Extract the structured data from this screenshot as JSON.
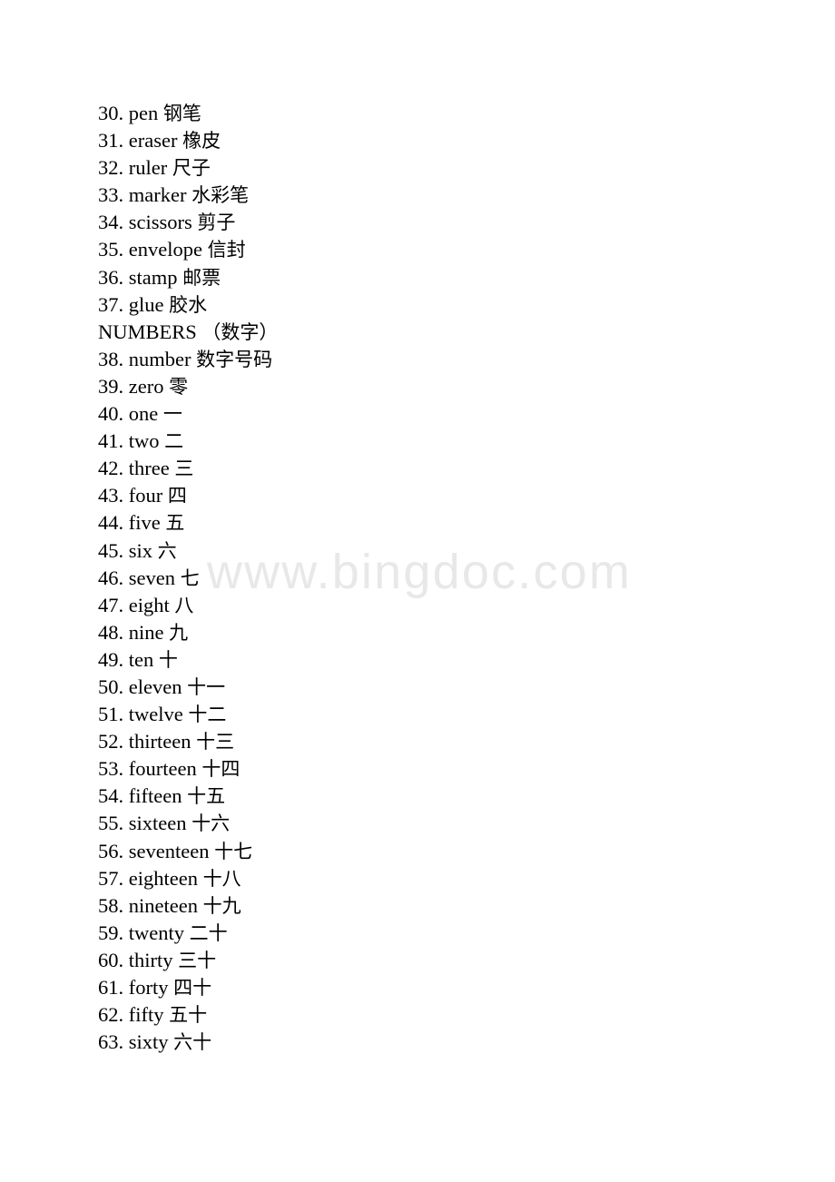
{
  "page": {
    "background_color": "#ffffff",
    "text_color": "#000000",
    "watermark": {
      "text": "www.bingdoc.com",
      "color": "#e8e8e8"
    }
  },
  "lines": [
    {
      "type": "entry",
      "num": "30.",
      "en": "pen",
      "zh": "钢笔"
    },
    {
      "type": "entry",
      "num": "31.",
      "en": "eraser",
      "zh": "橡皮"
    },
    {
      "type": "entry",
      "num": "32.",
      "en": "ruler",
      "zh": "尺子"
    },
    {
      "type": "entry",
      "num": "33.",
      "en": "marker",
      "zh": "水彩笔"
    },
    {
      "type": "entry",
      "num": "34.",
      "en": "scissors",
      "zh": "剪子"
    },
    {
      "type": "entry",
      "num": "35.",
      "en": "envelope",
      "zh": "信封"
    },
    {
      "type": "entry",
      "num": "36.",
      "en": "stamp",
      "zh": "邮票"
    },
    {
      "type": "entry",
      "num": "37.",
      "en": "glue",
      "zh": "胶水"
    },
    {
      "type": "heading",
      "num": "",
      "en": "NUMBERS",
      "zh": "（数字）"
    },
    {
      "type": "entry",
      "num": "38.",
      "en": "number",
      "zh": "数字号码"
    },
    {
      "type": "entry",
      "num": "39.",
      "en": "zero",
      "zh": "零"
    },
    {
      "type": "entry",
      "num": "40.",
      "en": "one",
      "zh": "一"
    },
    {
      "type": "entry",
      "num": "41.",
      "en": "two",
      "zh": "二"
    },
    {
      "type": "entry",
      "num": "42.",
      "en": "three",
      "zh": "三"
    },
    {
      "type": "entry",
      "num": "43.",
      "en": "four",
      "zh": "四"
    },
    {
      "type": "entry",
      "num": "44.",
      "en": "five",
      "zh": "五"
    },
    {
      "type": "entry",
      "num": "45.",
      "en": "six",
      "zh": "六"
    },
    {
      "type": "entry",
      "num": "46.",
      "en": "seven",
      "zh": "七"
    },
    {
      "type": "entry",
      "num": "47.",
      "en": "eight",
      "zh": "八"
    },
    {
      "type": "entry",
      "num": "48.",
      "en": "nine",
      "zh": "九"
    },
    {
      "type": "entry",
      "num": "49.",
      "en": "ten",
      "zh": "十"
    },
    {
      "type": "entry",
      "num": "50.",
      "en": "eleven",
      "zh": "十一"
    },
    {
      "type": "entry",
      "num": "51.",
      "en": "twelve",
      "zh": "十二"
    },
    {
      "type": "entry",
      "num": "52.",
      "en": "thirteen",
      "zh": "十三"
    },
    {
      "type": "entry",
      "num": "53.",
      "en": "fourteen",
      "zh": "十四"
    },
    {
      "type": "entry",
      "num": "54.",
      "en": "fifteen",
      "zh": "十五"
    },
    {
      "type": "entry",
      "num": "55.",
      "en": "sixteen",
      "zh": "十六"
    },
    {
      "type": "entry",
      "num": "56.",
      "en": "seventeen",
      "zh": "十七"
    },
    {
      "type": "entry",
      "num": "57.",
      "en": "eighteen",
      "zh": "十八"
    },
    {
      "type": "entry",
      "num": "58.",
      "en": "nineteen",
      "zh": "十九"
    },
    {
      "type": "entry",
      "num": "59.",
      "en": "twenty",
      "zh": "二十"
    },
    {
      "type": "entry",
      "num": "60.",
      "en": "thirty",
      "zh": "三十"
    },
    {
      "type": "entry",
      "num": "61.",
      "en": "forty",
      "zh": "四十"
    },
    {
      "type": "entry",
      "num": "62.",
      "en": "fifty",
      "zh": "五十"
    },
    {
      "type": "entry",
      "num": "63.",
      "en": "sixty",
      "zh": "六十"
    }
  ]
}
